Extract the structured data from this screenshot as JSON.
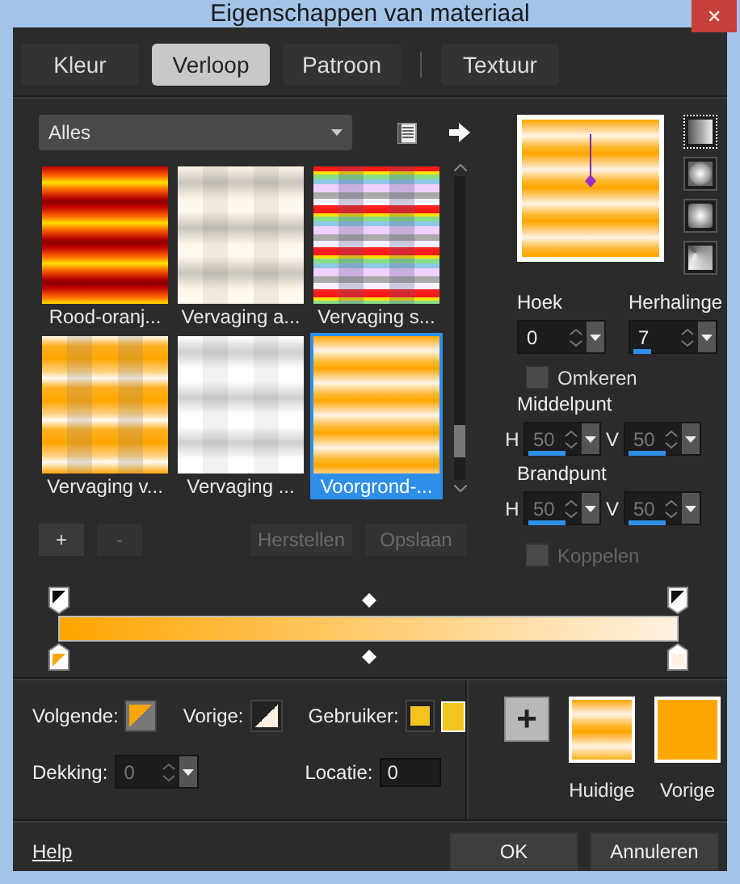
{
  "window": {
    "title": "Eigenschappen van materiaal",
    "close": "✕"
  },
  "tabs": [
    {
      "label": "Kleur",
      "selected": false
    },
    {
      "label": "Verloop",
      "selected": true
    },
    {
      "label": "Patroon",
      "selected": false
    },
    {
      "label": "Textuur",
      "selected": false
    }
  ],
  "category_dropdown": {
    "value": "Alles"
  },
  "gradients": [
    {
      "label": "Rood-oranj...",
      "kind": "red-yellow",
      "selected": false
    },
    {
      "label": "Vervaging a...",
      "kind": "cream-fade",
      "selected": false
    },
    {
      "label": "Vervaging s...",
      "kind": "rainbow",
      "selected": false
    },
    {
      "label": "Vervaging v...",
      "kind": "orange-fade",
      "selected": false
    },
    {
      "label": "Vervaging ...",
      "kind": "white-fade",
      "selected": false
    },
    {
      "label": "Voorgrond-...",
      "kind": "orange-stripes",
      "selected": true
    }
  ],
  "list_buttons": [
    {
      "label": "+",
      "disabled": false
    },
    {
      "label": "-",
      "disabled": true
    },
    {
      "label": "Herstellen",
      "disabled": true
    },
    {
      "label": "Opslaan",
      "disabled": true
    }
  ],
  "style_buttons": [
    {
      "kind": "linear",
      "selected": true
    },
    {
      "kind": "rectangular",
      "selected": false
    },
    {
      "kind": "radial",
      "selected": false
    },
    {
      "kind": "sunburst",
      "selected": false
    }
  ],
  "angle": {
    "label": "Hoek",
    "value": "0"
  },
  "repeats": {
    "label": "Herhalinge",
    "value": "7",
    "level": 0.2
  },
  "invert": {
    "label": "Omkeren",
    "checked": false,
    "disabled": false
  },
  "center": {
    "label": "Middelpunt",
    "fields": [
      {
        "axis": "H",
        "value": "50",
        "level": 0.5
      },
      {
        "axis": "V",
        "value": "50",
        "level": 0.5
      }
    ]
  },
  "focus": {
    "label": "Brandpunt",
    "fields": [
      {
        "axis": "H",
        "value": "50",
        "level": 0.5
      },
      {
        "axis": "V",
        "value": "50",
        "level": 0.5
      }
    ]
  },
  "link": {
    "label": "Koppelen",
    "checked": false,
    "disabled": true
  },
  "stop": {
    "next_label": "Volgende:",
    "previous_label": "Vorige:",
    "user_label": "Gebruiker:",
    "opacity_label": "Dekking:",
    "opacity_value": "0",
    "location_label": "Locatie:",
    "location_value": "0"
  },
  "add_button": "+",
  "swatches": [
    {
      "label": "Huidige",
      "kind": "gradient"
    },
    {
      "label": "Vorige",
      "kind": "solid",
      "color": "#ffa500"
    }
  ],
  "help_link": "Help",
  "buttons": [
    {
      "label": "OK"
    },
    {
      "label": "Annuleren"
    }
  ]
}
